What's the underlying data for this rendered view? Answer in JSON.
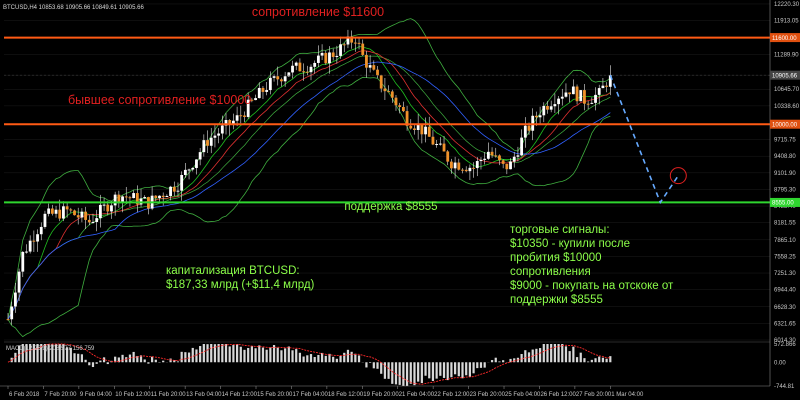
{
  "chart_data": {
    "type": "candlestick",
    "header": "BTCUSD,H4  10853.68 10905.66 10849.61 10905.66",
    "colors": {
      "background": "#000000",
      "bull": "#ffffff",
      "bear": "#f0922b",
      "wick": "#e8e8e8",
      "grid": "#1c1c1c",
      "resistance_line": "#ff5a14",
      "support_line": "#2fd62f",
      "annotation_red": "#e02020",
      "annotation_green": "#8cff4a",
      "bollinger": "#3fae3f",
      "ma_red": "#e03030",
      "ma_blue": "#3060ff",
      "ma_green": "#20c020",
      "macd_hist": "#d8d8d8",
      "macd_signal": "#ff2a2a",
      "forecast": "#66aaff",
      "price_tag": "#e05010"
    },
    "ylim": [
      6014.3,
      12220
    ],
    "yticks": [
      "12220.30",
      "11913.05",
      "11600",
      "11289.90",
      "10905.66",
      "10645.70",
      "10338.60",
      "10000",
      "9715.75",
      "9408.80",
      "9101.90",
      "8795.30",
      "8555",
      "8488.40",
      "8181.55",
      "7865.10",
      "7558.25",
      "7251.30",
      "6944.40",
      "6628.30",
      "6321.65",
      "6014.30"
    ],
    "xticks": [
      "6 Feb 2018",
      "7 Feb 20:00",
      "9 Feb 04:00",
      "10 Feb 12:00",
      "11 Feb 20:00",
      "13 Feb 04:00",
      "14 Feb 12:00",
      "15 Feb 20:00",
      "17 Feb 04:00",
      "18 Feb 12:00",
      "19 Feb 20:00",
      "21 Feb 04:00",
      "22 Feb 12:00",
      "23 Feb 20:00",
      "25 Feb 04:00",
      "26 Feb 12:00",
      "27 Feb 20:00",
      "1 Mar 04:00"
    ],
    "levels": {
      "resistance": 11600,
      "former_resistance": 10000,
      "support": 8555,
      "current": 10905.66
    },
    "price_tags": [
      "11600.00",
      "10000.00",
      "8555.00",
      "10905.66"
    ],
    "annotations": {
      "resistance": "сопротивление $11600",
      "former_resistance": "бывшее сопротивление $10000",
      "support": "поддержка $8555",
      "cap_line1": "капитализация BTCUSD:",
      "cap_line2": "$187,33 млрд (+$11,4 млрд)",
      "signals": [
        "торговые сигналы:",
        "$10350 - купили после",
        "пробития $10000",
        "сопротивления",
        "$9000 - покупать на отскоке от",
        "поддержки $8555"
      ]
    },
    "forecast": {
      "from": 10905.66,
      "low": 8555,
      "target": 9050
    },
    "macd": {
      "label": "MACD(12,26,9) 208.577 156.759",
      "ticks": [
        "572.866",
        "0.00",
        "-744.81"
      ],
      "range": [
        -744.81,
        572.866
      ]
    },
    "series_keypoints": [
      [
        0,
        6400
      ],
      [
        4,
        7600
      ],
      [
        10,
        8300
      ],
      [
        16,
        8400
      ],
      [
        22,
        8200
      ],
      [
        30,
        8700
      ],
      [
        38,
        8550
      ],
      [
        46,
        8900
      ],
      [
        54,
        9700
      ],
      [
        62,
        10100
      ],
      [
        70,
        10700
      ],
      [
        76,
        11000
      ],
      [
        82,
        11100
      ],
      [
        88,
        11300
      ],
      [
        94,
        11600
      ],
      [
        96,
        11250
      ],
      [
        100,
        10800
      ],
      [
        104,
        10500
      ],
      [
        108,
        10100
      ],
      [
        112,
        9900
      ],
      [
        116,
        9600
      ],
      [
        120,
        9300
      ],
      [
        126,
        9200
      ],
      [
        130,
        9500
      ],
      [
        134,
        9200
      ],
      [
        136,
        9250
      ],
      [
        140,
        9850
      ],
      [
        144,
        10250
      ],
      [
        148,
        10500
      ],
      [
        152,
        10650
      ],
      [
        156,
        10450
      ],
      [
        160,
        10550
      ],
      [
        163,
        10905
      ]
    ]
  }
}
